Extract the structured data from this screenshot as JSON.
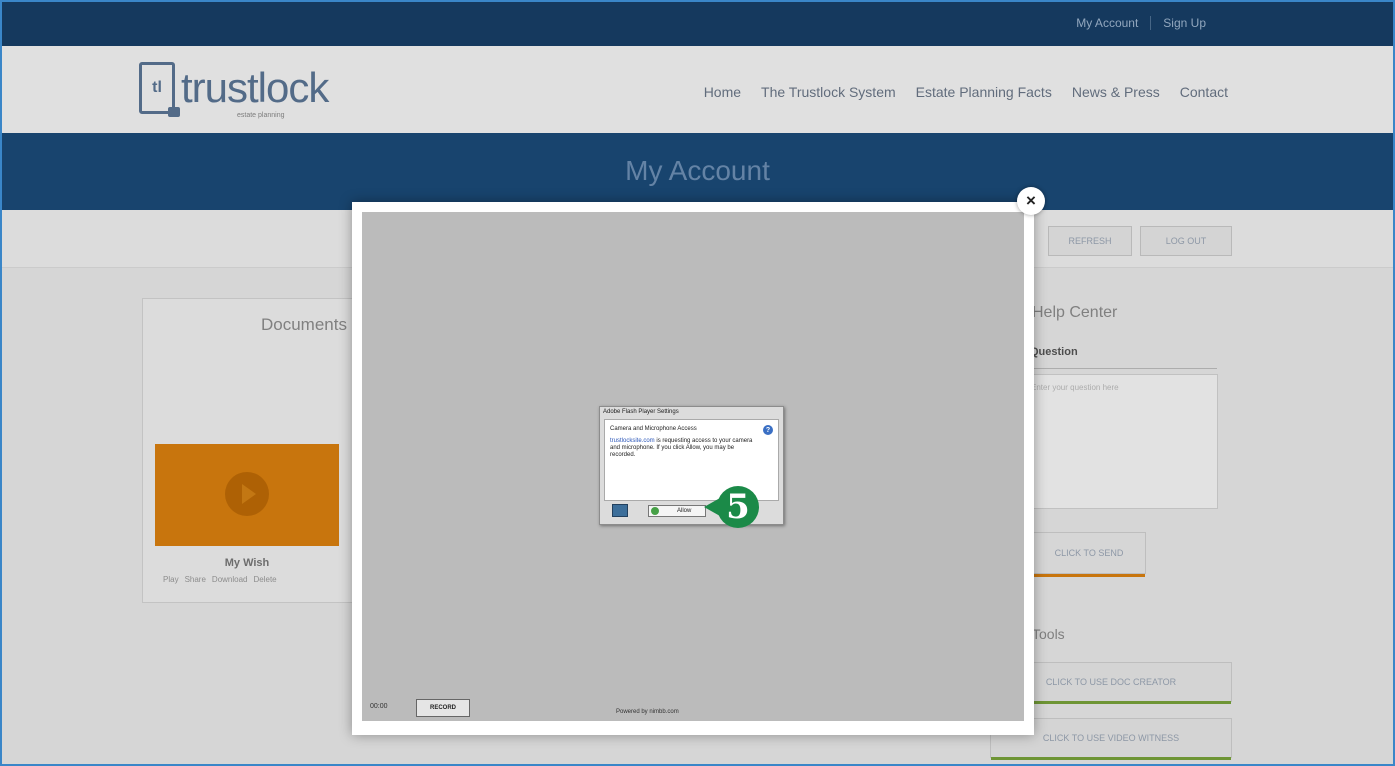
{
  "topbar": {
    "links": [
      "My Account",
      "Sign Up"
    ]
  },
  "brand": {
    "logo_letters": "tl",
    "name": "trustlock",
    "tagline": "estate planning"
  },
  "nav": {
    "items": [
      "Home",
      "The Trustlock System",
      "Estate Planning Facts",
      "News & Press",
      "Contact"
    ]
  },
  "band": {
    "title": "My Account"
  },
  "toolbar": {
    "buttons": [
      "REFRESH",
      "LOG OUT"
    ]
  },
  "documents": {
    "title": "Documents",
    "item": {
      "title": "My Wish",
      "actions": [
        "Play",
        "Share",
        "Download",
        "Delete"
      ]
    }
  },
  "help": {
    "title": "Help Center",
    "question_label": "Question",
    "placeholder": "Enter your question here",
    "submit_label": "CLICK TO SEND",
    "section_title": "Tools",
    "tool_buttons": [
      "CLICK TO USE DOC CREATOR",
      "CLICK TO USE VIDEO WITNESS"
    ]
  },
  "modal": {
    "close_label": "×",
    "recorder": {
      "time": "00:00",
      "record_label": "RECORD",
      "powered_by": "Powered by nimbb.com"
    },
    "flash": {
      "title": "Adobe Flash Player Settings",
      "subtitle": "Camera and Microphone Access",
      "help_label": "?",
      "site": "trustlocksite.com",
      "message": " is requesting access to your camera and microphone. If you click Allow, you may be recorded.",
      "allow_label": "Allow"
    }
  },
  "callout": {
    "number": "5",
    "color": "#1b8a48"
  },
  "colors": {
    "navy": "#173e66",
    "band": "#1b4a78",
    "orange": "#d97f0f",
    "green": "#78a23a"
  }
}
